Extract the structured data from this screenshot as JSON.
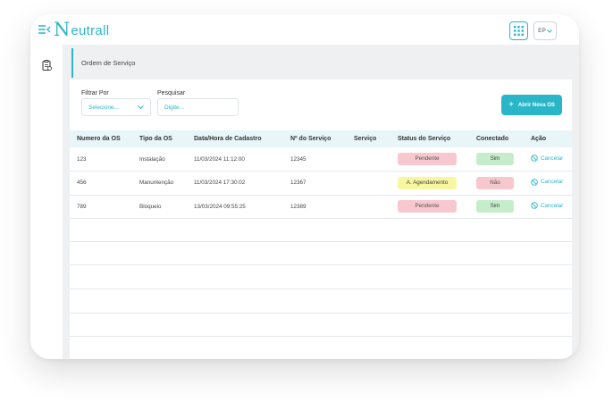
{
  "brand": {
    "logo_mark": "N",
    "logo_text": "eutrall"
  },
  "header": {
    "user_initials": "EP"
  },
  "page": {
    "title": "Ordem de Serviço"
  },
  "filters": {
    "filter_label": "Filtrar Por",
    "filter_placeholder": "Selecione...",
    "search_label": "Pesquisar",
    "search_placeholder": "Digite..."
  },
  "actions": {
    "new_os_label": "Abrir Nova OS"
  },
  "table": {
    "columns": [
      "Numero da OS",
      "Tipo da OS",
      "Data/Hora de Cadastro",
      "Nº do Serviço",
      "Serviço",
      "Status do Serviço",
      "Conectado",
      "Ação"
    ],
    "rows": [
      {
        "numero": "123",
        "tipo": "Instalação",
        "data": "11/03/2024 11:12:00",
        "servico_num": "12345",
        "servico": "",
        "status": "Pendente",
        "conectado": "Sim",
        "acao": "Cancelar"
      },
      {
        "numero": "456",
        "tipo": "Manuntenção",
        "data": "11/03/2024 17:30:02",
        "servico_num": "12367",
        "servico": "",
        "status": "A. Agendamento",
        "conectado": "Não",
        "acao": "Cancelar"
      },
      {
        "numero": "789",
        "tipo": "Bloqueio",
        "data": "13/03/2024 09:55:25",
        "servico_num": "12389",
        "servico": "",
        "status": "Pendente",
        "conectado": "Sim",
        "acao": "Cancelar"
      }
    ]
  },
  "colors": {
    "accent": "#29b6c9",
    "status_pendente": "#f8c8cf",
    "status_agendamento": "#f7f7a0",
    "conectado_sim": "#c6edc9",
    "conectado_nao": "#f8c8cf"
  },
  "icons": {
    "menu": "menu-collapse-icon",
    "apps": "grid-icon",
    "sidebar": "clipboard-icon",
    "chevron": "chevron-down-icon",
    "plus": "plus-icon",
    "cancel": "cancel-circle-icon"
  }
}
